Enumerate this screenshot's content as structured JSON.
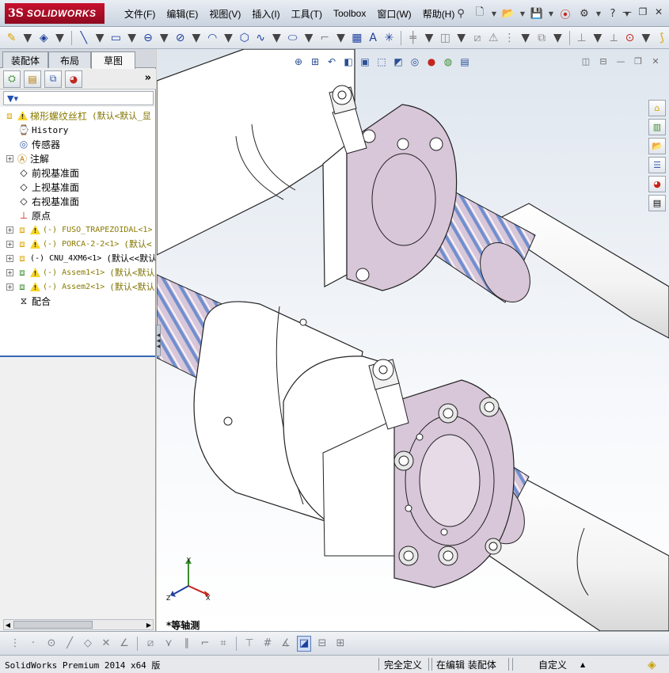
{
  "app": {
    "logo_ds": "3S",
    "logo_text": "SOLIDWORKS"
  },
  "menu": [
    {
      "id": "file",
      "label": "文件(F)"
    },
    {
      "id": "edit",
      "label": "编辑(E)"
    },
    {
      "id": "view",
      "label": "视图(V)"
    },
    {
      "id": "insert",
      "label": "插入(I)"
    },
    {
      "id": "tools",
      "label": "工具(T)"
    },
    {
      "id": "toolbox",
      "label": "Toolbox"
    },
    {
      "id": "window",
      "label": "窗口(W)"
    },
    {
      "id": "help",
      "label": "帮助(H)"
    }
  ],
  "window_controls": {
    "minimize": "—",
    "restore": "❐",
    "close": "✕"
  },
  "manager_tabs": [
    {
      "label": "装配体",
      "active": false
    },
    {
      "label": "布局",
      "active": false
    },
    {
      "label": "草图",
      "active": true
    }
  ],
  "tree": {
    "root": {
      "label": "梯形螺纹丝杠",
      "config": "(默认<默认_显"
    },
    "items": [
      {
        "label": "History",
        "icon": "history-icon"
      },
      {
        "label": "传感器",
        "icon": "sensor-icon"
      },
      {
        "label": "注解",
        "icon": "annotation-icon",
        "expandable": true
      },
      {
        "label": "前视基准面",
        "icon": "plane-icon"
      },
      {
        "label": "上视基准面",
        "icon": "plane-icon"
      },
      {
        "label": "右视基准面",
        "icon": "plane-icon"
      },
      {
        "label": "原点",
        "icon": "origin-icon"
      }
    ],
    "components": [
      {
        "label": "(-) FUSO_TRAPEZOIDAL<1>",
        "config": "",
        "warning": true
      },
      {
        "label": "(-) PORCA-2-2<1>",
        "config": "(默认<",
        "warning": true
      },
      {
        "label": "(-) CNU_4XM6<1>",
        "config": "(默认<<默认",
        "warning": false
      },
      {
        "label": "(-) Assem1<1>",
        "config": "(默认<默认",
        "warning": true
      },
      {
        "label": "(-) Assem2<1>",
        "config": "(默认<默认",
        "warning": true
      }
    ],
    "mates": {
      "label": "配合"
    }
  },
  "viewport": {
    "view_name": "*等轴测"
  },
  "triad": {
    "x": "X",
    "y": "Y",
    "z": "Z"
  },
  "status": {
    "app_version": "SolidWorks Premium 2014 x64 版",
    "state": "完全定义",
    "mode": "在编辑 装配体",
    "units": "自定义",
    "units_arrow": "▲"
  },
  "colors": {
    "flange": "#d8c6d9",
    "thread": "#6f8fcf",
    "shaft": "#ffffff",
    "outline": "#222222",
    "accent": "#c8102e"
  }
}
